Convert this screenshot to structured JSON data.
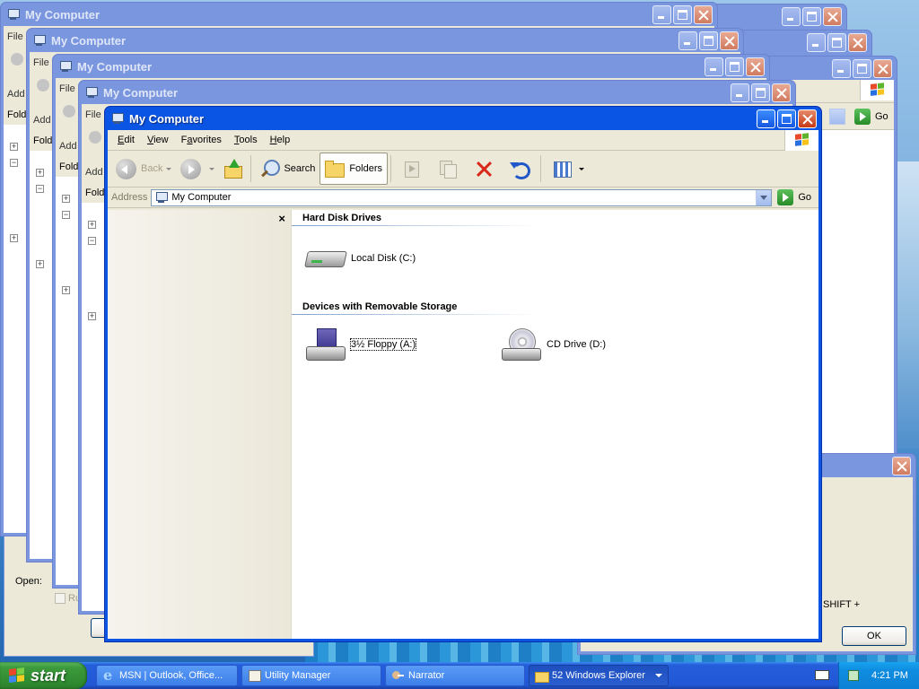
{
  "windows": {
    "background_title": "My Computer",
    "background_menu_fragment": "File",
    "background_address_fragment": "Add",
    "background_folders_fragment": "Fold"
  },
  "main_window": {
    "title": "My Computer",
    "menu": [
      "Edit",
      "View",
      "Favorites",
      "Tools",
      "Help"
    ],
    "menu_access_keys": [
      "E",
      "V",
      "a",
      "T",
      "H"
    ],
    "toolbar": {
      "back_label": "Back",
      "search_label": "Search",
      "folders_label": "Folders"
    },
    "address": {
      "label": "Address",
      "value": "My Computer",
      "go_label": "Go"
    },
    "groups": [
      {
        "header": "Hard Disk Drives",
        "items": [
          {
            "label": "Local Disk (C:)",
            "icon": "hard-disk-icon",
            "selected": false
          }
        ]
      },
      {
        "header": "Devices with Removable Storage",
        "items": [
          {
            "label": "3½ Floppy (A:)",
            "icon": "floppy-drive-icon",
            "selected": true
          },
          {
            "label": "CD Drive (D:)",
            "icon": "cd-drive-icon",
            "selected": false
          }
        ]
      }
    ]
  },
  "back_window_right": {
    "go_label": "Go",
    "shortcut_fragment": "SHIFT +",
    "ok_label": "OK"
  },
  "run_dialog": {
    "open_label": "Open:",
    "checkbox_fragment": "Ru"
  },
  "taskbar": {
    "start_label": "start",
    "tasks": [
      {
        "label": "MSN | Outlook, Office...",
        "icon": "ie-icon"
      },
      {
        "label": "Utility Manager",
        "icon": "utility-manager-icon"
      },
      {
        "label": "Narrator",
        "icon": "narrator-icon"
      },
      {
        "label": "52 Windows Explorer",
        "icon": "folder-icon",
        "active": true
      }
    ],
    "clock": "4:21 PM"
  }
}
